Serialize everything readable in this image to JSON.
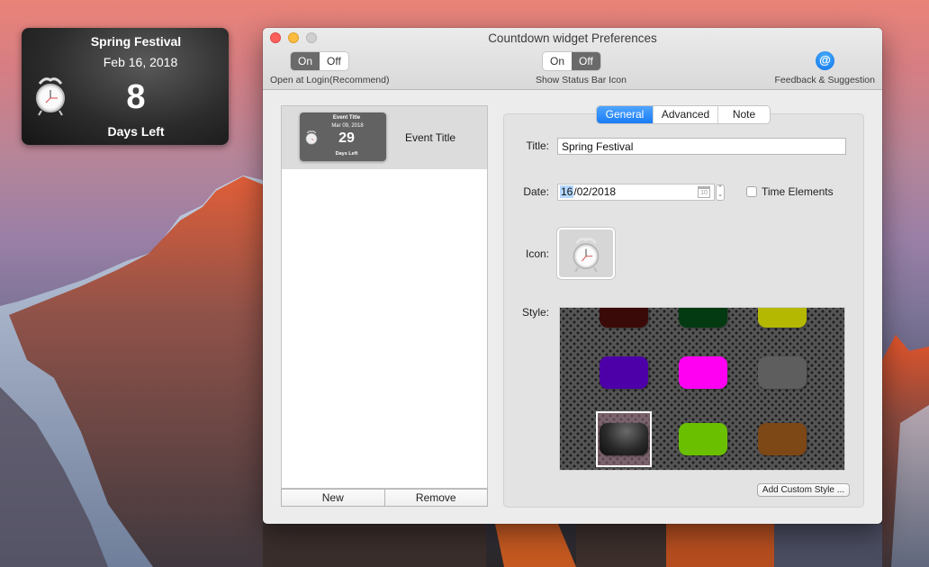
{
  "desktop_widget": {
    "title": "Spring Festival",
    "date": "Feb 16, 2018",
    "count": "8",
    "footer": "Days Left",
    "icon": "alarm-clock-icon"
  },
  "window": {
    "title": "Countdown widget Preferences",
    "toolbar": {
      "login_toggle": {
        "on_label": "On",
        "off_label": "Off",
        "selected": "On",
        "caption": "Open at Login(Recommend)"
      },
      "status_toggle": {
        "on_label": "On",
        "off_label": "Off",
        "selected": "Off",
        "caption": "Show Status Bar Icon"
      },
      "feedback": {
        "icon": "@",
        "caption": "Feedback & Suggestion",
        "color": "#1a7cf5"
      }
    },
    "event_list": {
      "items": [
        {
          "label": "Event Title",
          "preview": {
            "title": "Event Title",
            "date": "Mar 09, 2018",
            "count": "29",
            "footer": "Days Left"
          },
          "selected": true
        }
      ],
      "new_label": "New",
      "remove_label": "Remove"
    },
    "tabs": [
      {
        "label": "General",
        "active": true
      },
      {
        "label": "Advanced",
        "active": false
      },
      {
        "label": "Note",
        "active": false
      }
    ],
    "general": {
      "title_label": "Title:",
      "title_value": "Spring Festival",
      "date_label": "Date:",
      "date_selected_part": "16",
      "date_rest": "/02/2018",
      "calendar_icon_text": "10",
      "time_elements_label": "Time Elements",
      "time_elements_checked": false,
      "icon_label": "Icon:",
      "style_label": "Style:",
      "styles": [
        {
          "color": "#3a0a08",
          "name": "dark-red"
        },
        {
          "color": "#043a12",
          "name": "dark-green"
        },
        {
          "color": "#b4b800",
          "name": "olive-yellow"
        },
        {
          "color": "#4d00a8",
          "name": "purple"
        },
        {
          "color": "#ff00f2",
          "name": "magenta"
        },
        {
          "color": "#5e5e5e",
          "name": "gray"
        },
        {
          "color": "#2a2a2a",
          "name": "black-gloss",
          "selected": true
        },
        {
          "color": "#6abf00",
          "name": "lime-green"
        },
        {
          "color": "#7d4716",
          "name": "brown"
        }
      ],
      "add_custom_style_label": "Add Custom Style ..."
    }
  }
}
